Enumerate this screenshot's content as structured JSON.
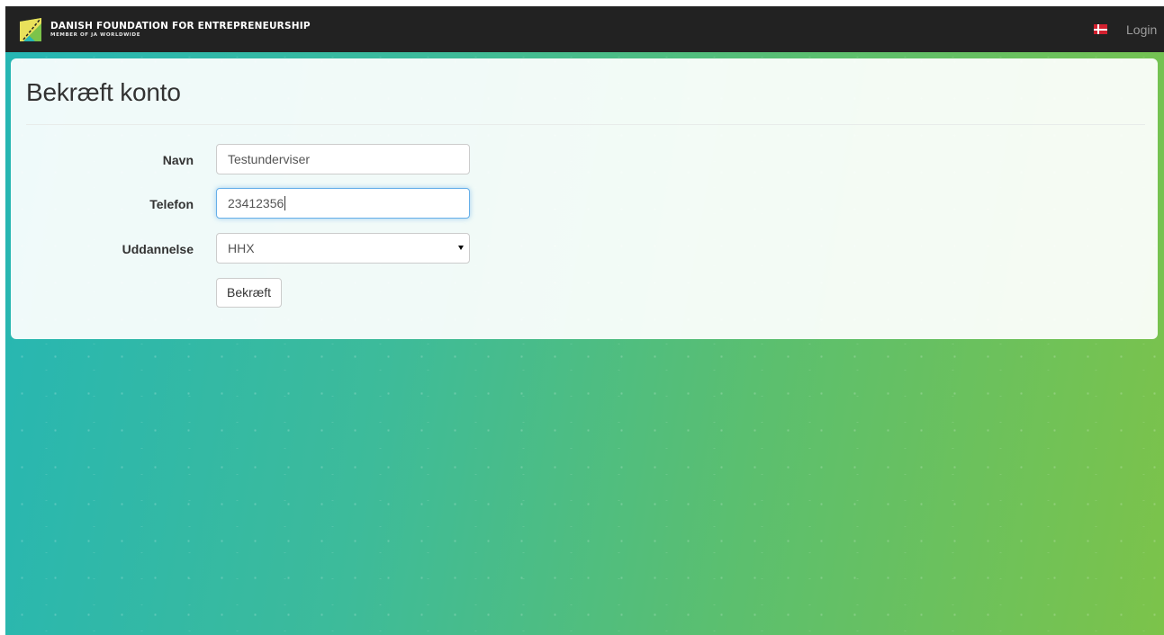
{
  "header": {
    "brand_title": "DANISH FOUNDATION FOR ENTREPRENEURSHIP",
    "brand_subtitle": "MEMBER OF JA WORLDWIDE",
    "login_label": "Login",
    "language_flag": "denmark-flag-icon",
    "logo": "dfe-logo-icon"
  },
  "form": {
    "title": "Bekræft konto",
    "fields": {
      "name": {
        "label": "Navn",
        "value": "Testunderviser"
      },
      "phone": {
        "label": "Telefon",
        "value": "23412356"
      },
      "education": {
        "label": "Uddannelse",
        "value": "HHX"
      }
    },
    "submit_label": "Bekræft"
  },
  "colors": {
    "navbar": "#222222",
    "gradient_start": "#25b6b4",
    "gradient_end": "#7cc34a",
    "focus_border": "#66afe9"
  }
}
